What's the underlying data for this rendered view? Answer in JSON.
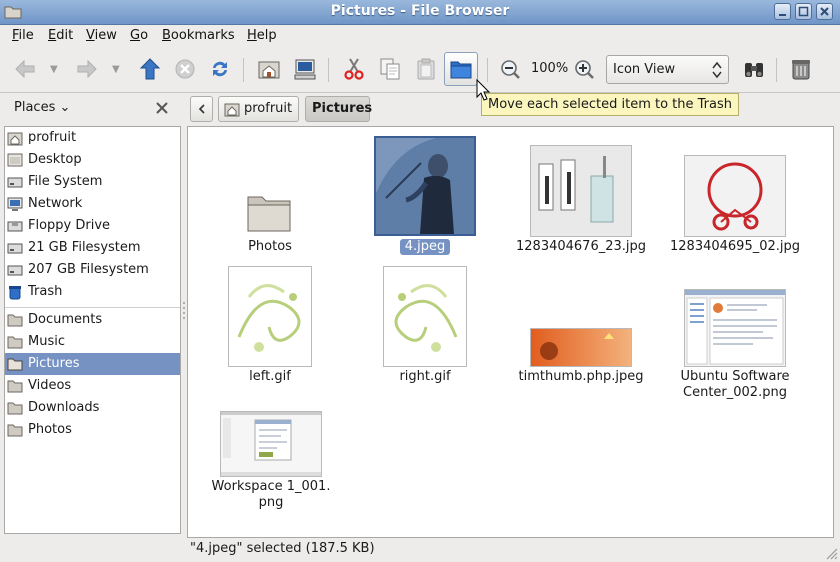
{
  "window": {
    "title": "Pictures - File Browser"
  },
  "menubar": [
    {
      "mnemonic": "F",
      "rest": "ile"
    },
    {
      "mnemonic": "E",
      "rest": "dit"
    },
    {
      "mnemonic": "V",
      "rest": "iew"
    },
    {
      "mnemonic": "G",
      "rest": "o"
    },
    {
      "mnemonic": "B",
      "rest": "ookmarks"
    },
    {
      "mnemonic": "H",
      "rest": "elp"
    }
  ],
  "toolbar": {
    "zoom_level": "100%",
    "view_mode": "Icon View"
  },
  "tooltip": "Move each selected item to the Trash",
  "sidepane": {
    "header": "Places",
    "items": [
      {
        "label": "profruit",
        "icon": "home-icon"
      },
      {
        "label": "Desktop",
        "icon": "desktop-icon"
      },
      {
        "label": "File System",
        "icon": "drive-icon"
      },
      {
        "label": "Network",
        "icon": "network-icon"
      },
      {
        "label": "Floppy Drive",
        "icon": "floppy-icon"
      },
      {
        "label": "21 GB Filesystem",
        "icon": "drive-icon"
      },
      {
        "label": "207 GB Filesystem",
        "icon": "drive-icon"
      },
      {
        "label": "Trash",
        "icon": "trash-icon"
      }
    ],
    "bookmarks": [
      {
        "label": "Documents",
        "icon": "folder-icon"
      },
      {
        "label": "Music",
        "icon": "folder-icon"
      },
      {
        "label": "Pictures",
        "icon": "folder-icon",
        "active": true
      },
      {
        "label": "Videos",
        "icon": "folder-icon"
      },
      {
        "label": "Downloads",
        "icon": "folder-icon"
      },
      {
        "label": "Photos",
        "icon": "folder-icon"
      }
    ]
  },
  "pathbar": {
    "segments": [
      "profruit",
      "Pictures"
    ]
  },
  "files": [
    {
      "name": "Photos",
      "kind": "folder"
    },
    {
      "name": "4.jpeg",
      "kind": "image",
      "selected": true
    },
    {
      "name": "1283404676_23.jpg",
      "kind": "image"
    },
    {
      "name": "1283404695_02.jpg",
      "kind": "image"
    },
    {
      "name": "left.gif",
      "kind": "image"
    },
    {
      "name": "right.gif",
      "kind": "image"
    },
    {
      "name": "timthumb.php.jpeg",
      "kind": "image"
    },
    {
      "name_line1": "Ubuntu Software",
      "name_line2": "Center_002.png",
      "kind": "image"
    },
    {
      "name_line1": "Workspace 1_001.",
      "name_line2": "png",
      "kind": "image"
    }
  ],
  "status": "\"4.jpeg\" selected (187.5 KB)",
  "colors": {
    "titlebar": "#7ea1cf",
    "selection": "#7592c2",
    "tooltip": "#fbf6be"
  }
}
